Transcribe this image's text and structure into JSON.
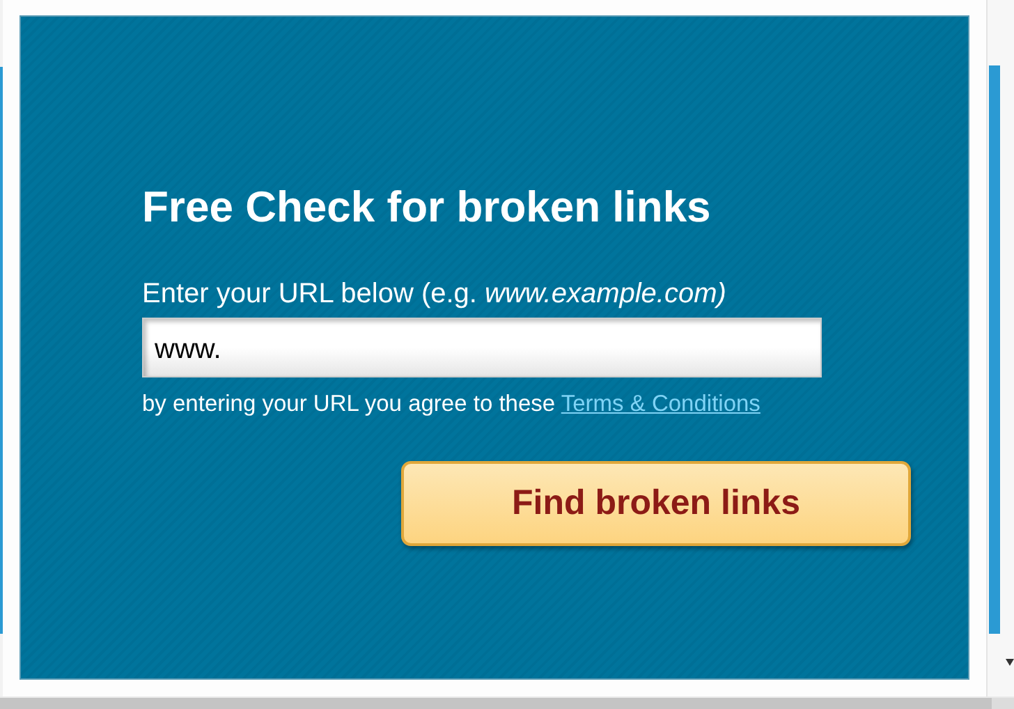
{
  "dialog": {
    "title": "Free Check for broken links",
    "url_label": "Enter your URL below (e.g. *www.example.com)*",
    "url_field": {
      "value": "www."
    },
    "terms_notice": {
      "text": "by entering your URL you agree to these",
      "link": "Terms & Conditions"
    },
    "submit_button": "Find broken links"
  }
}
